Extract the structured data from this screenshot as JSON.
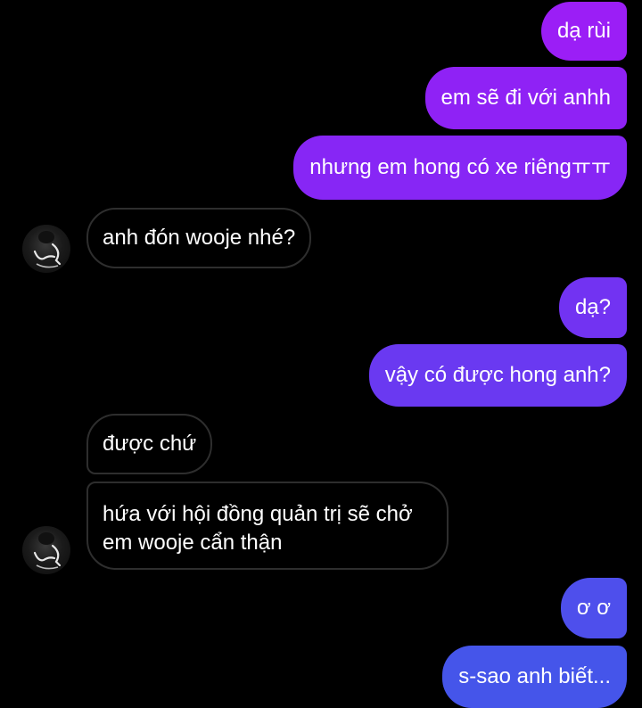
{
  "colors": {
    "background": "#000000",
    "incoming_border": "#2e2e2e",
    "outgoing_gradient": [
      "#9b1ef6",
      "#7b2ff4",
      "#5b43ec",
      "#4655ea"
    ]
  },
  "messages": [
    {
      "side": "out",
      "text": "dạ rùi",
      "color": "#9b1ef6"
    },
    {
      "side": "out",
      "text": "em sẽ đi với anhh",
      "color": "#8f22f5"
    },
    {
      "side": "out",
      "text": "nhưng em hong có xe riêngㅠㅠ",
      "color": "#8726f5"
    },
    {
      "side": "in",
      "text": "anh đón wooje nhé?",
      "avatar_icon": "user-avatar-icon"
    },
    {
      "side": "out",
      "text": "dạ?",
      "color": "#7233f2"
    },
    {
      "side": "out",
      "text": "vậy có được hong anh?",
      "color": "#6a39f1"
    },
    {
      "side": "in",
      "text": "được chứ"
    },
    {
      "side": "in",
      "text": "hứa với hội đồng quản trị sẽ chở em wooje cẩn thận",
      "avatar_icon": "user-avatar-icon"
    },
    {
      "side": "out",
      "text": "ơ ơ",
      "color": "#4e4fec"
    },
    {
      "side": "out",
      "text": "s-sao anh biết...",
      "color": "#4555ea"
    }
  ]
}
